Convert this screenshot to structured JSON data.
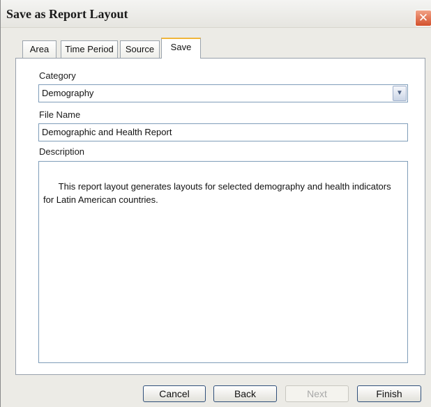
{
  "window": {
    "title": "Save as Report Layout",
    "close_glyph": "✕"
  },
  "tabs": [
    {
      "label": "Area"
    },
    {
      "label": "Time Period"
    },
    {
      "label": "Source"
    },
    {
      "label": "Save",
      "active": true
    }
  ],
  "form": {
    "category_label": "Category",
    "category_value": "Demography",
    "category_arrow": "▼",
    "file_name_label": "File Name",
    "file_name_value": "Demographic and Health Report",
    "description_label": "Description",
    "description_value": "This report layout generates layouts for selected demography and health indicators for Latin American countries."
  },
  "buttons": {
    "cancel": "Cancel",
    "back": "Back",
    "next": "Next",
    "finish": "Finish"
  },
  "colors": {
    "active_tab_accent": "#f0b63a",
    "close_button": "#d3502c",
    "field_border": "#7f9db9"
  }
}
